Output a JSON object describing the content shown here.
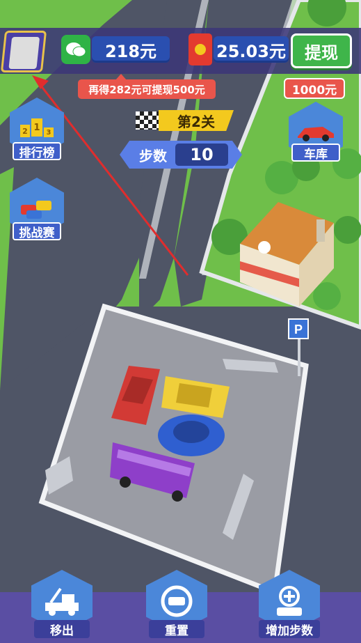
{
  "header": {
    "wechat_balance": "218元",
    "redpack_balance": "25.03元",
    "withdraw_label": "提现",
    "tip": "再得282元可提现500元"
  },
  "side_left": {
    "leaderboard_label": "排行榜",
    "leaderboard_digits": [
      "2",
      "1",
      "3"
    ],
    "challenge_label": "挑战赛"
  },
  "side_right": {
    "garage_label": "车库",
    "garage_price": "1000元"
  },
  "level": {
    "label": "第2关",
    "steps_label": "步数",
    "steps_value": "10"
  },
  "parking_sign": "P",
  "bottom": {
    "move_out_label": "移出",
    "reset_label": "重置",
    "add_steps_label": "增加步数"
  },
  "colors": {
    "grass": "#6fbf4a",
    "road": "#4f5566",
    "lot": "#9a9ca4",
    "bar": "#5a4ea3",
    "accent_red": "#e9554b",
    "accent_yellow": "#f3c91e",
    "withdraw_green": "#3fb54a"
  }
}
